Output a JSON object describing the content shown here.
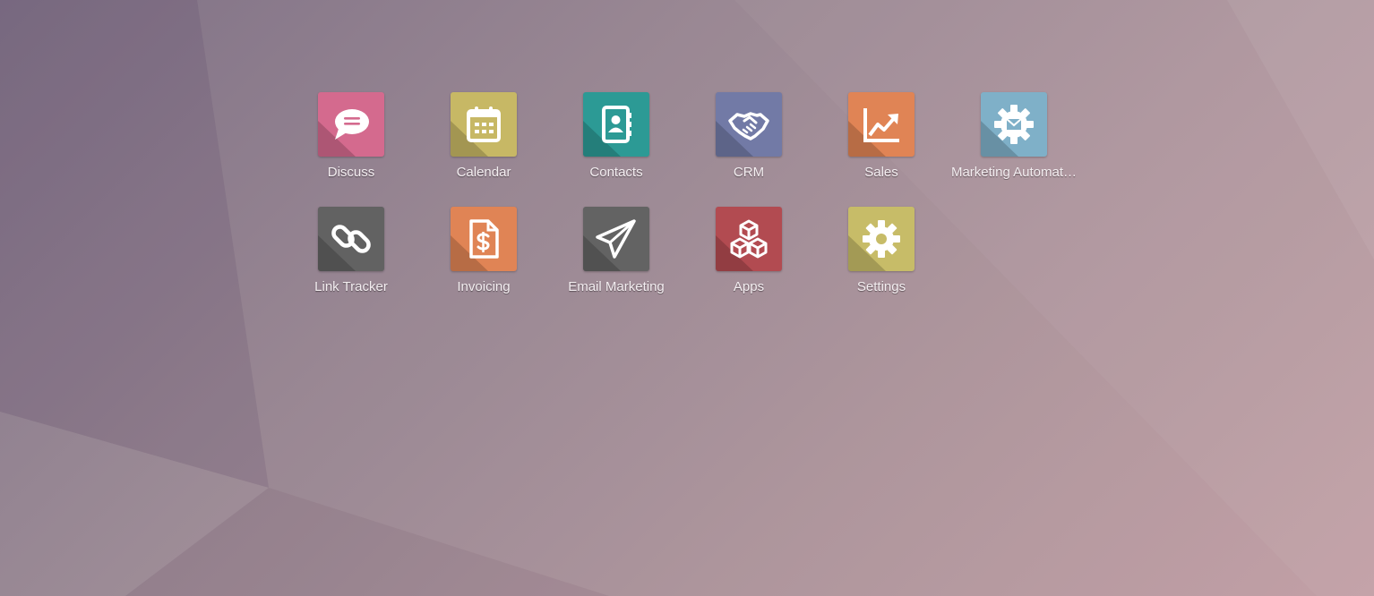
{
  "apps": [
    {
      "label": "Discuss",
      "icon": "chat-bubble-icon",
      "color": "#d46a8e"
    },
    {
      "label": "Calendar",
      "icon": "calendar-icon",
      "color": "#c7b865"
    },
    {
      "label": "Contacts",
      "icon": "address-book-icon",
      "color": "#2c9a95"
    },
    {
      "label": "CRM",
      "icon": "handshake-icon",
      "color": "#727aa6"
    },
    {
      "label": "Sales",
      "icon": "trending-chart-icon",
      "color": "#e08455"
    },
    {
      "label": "Marketing Automat…",
      "icon": "gear-envelope-icon",
      "color": "#7fb0c8"
    },
    {
      "label": "Link Tracker",
      "icon": "chain-link-icon",
      "color": "#626262"
    },
    {
      "label": "Invoicing",
      "icon": "invoice-dollar-icon",
      "color": "#e08455"
    },
    {
      "label": "Email Marketing",
      "icon": "paper-plane-icon",
      "color": "#636363"
    },
    {
      "label": "Apps",
      "icon": "cubes-icon",
      "color": "#b24b51"
    },
    {
      "label": "Settings",
      "icon": "gear-icon",
      "color": "#c7bc68"
    }
  ]
}
